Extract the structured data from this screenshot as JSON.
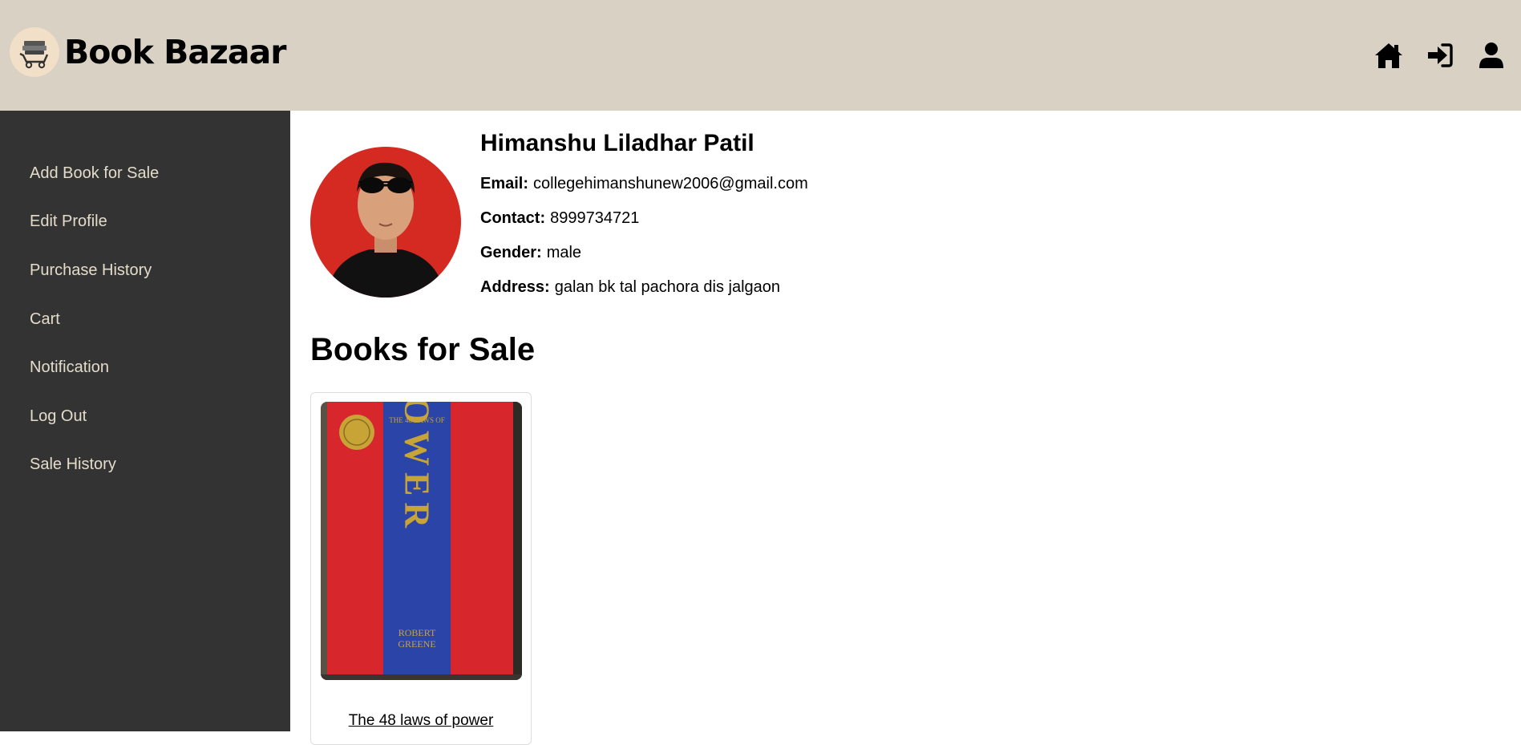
{
  "app": {
    "brand": "Book Bazaar"
  },
  "header": {
    "icons": [
      {
        "name": "home-icon"
      },
      {
        "name": "login-icon"
      },
      {
        "name": "user-icon"
      }
    ]
  },
  "sidebar": {
    "items": [
      {
        "label": "Add Book for Sale"
      },
      {
        "label": "Edit Profile"
      },
      {
        "label": "Purchase History"
      },
      {
        "label": "Cart"
      },
      {
        "label": "Notification"
      },
      {
        "label": "Log Out"
      },
      {
        "label": "Sale History"
      }
    ]
  },
  "profile": {
    "name": "Himanshu Liladhar Patil",
    "email_label": "Email:",
    "email": "collegehimanshunew2006@gmail.com",
    "contact_label": "Contact:",
    "contact": "8999734721",
    "gender_label": "Gender:",
    "gender": "male",
    "address_label": "Address:",
    "address": "galan bk tal pachora dis jalgaon"
  },
  "books_section": {
    "title": "Books for Sale",
    "books": [
      {
        "title": "The 48 laws of power",
        "cover_top": "THE 48 LAWS OF",
        "cover_word": "POWER",
        "cover_author_1": "ROBERT",
        "cover_author_2": "GREENE"
      }
    ]
  },
  "colors": {
    "header_bg": "#d8d1c4",
    "sidebar_bg": "#333333",
    "sidebar_text": "#e4dccb",
    "cover_red": "#d8262d",
    "cover_blue": "#2b44a8",
    "cover_gold": "#c8a437"
  }
}
